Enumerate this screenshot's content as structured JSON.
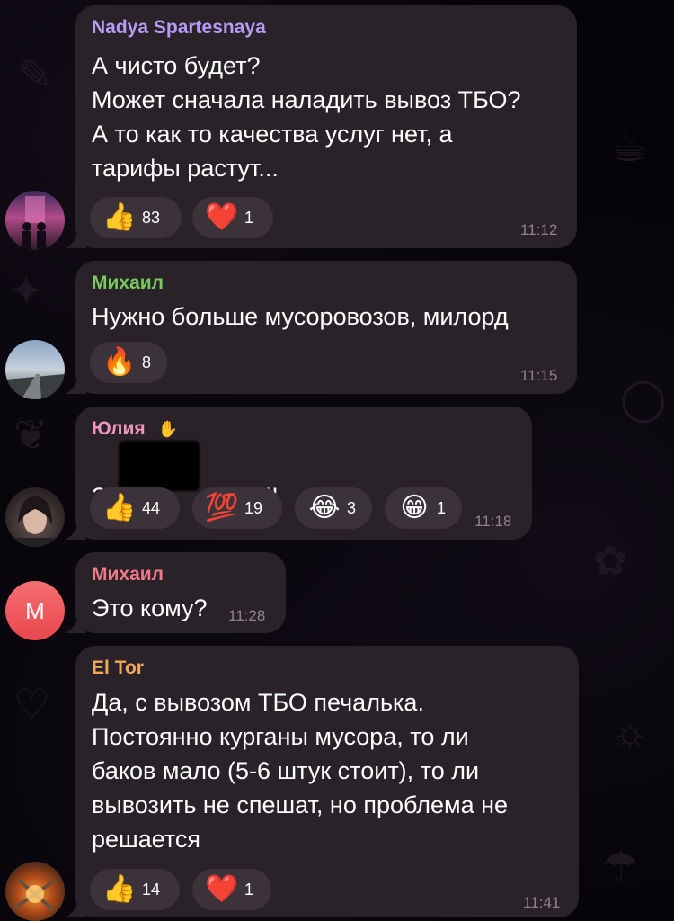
{
  "messages": [
    {
      "sender": "Nadya Spartesnaya",
      "sender_color": "#b79af5",
      "text": "А чисто будет?\nМожет сначала наладить вывоз ТБО?\nА то как то качества услуг нет, а\nтарифы растут...",
      "time": "11:12",
      "reactions": [
        {
          "emoji": "👍",
          "count": "83"
        },
        {
          "emoji": "❤️",
          "count": "1"
        }
      ]
    },
    {
      "sender": "Михаил",
      "sender_color": "#78c95e",
      "text": "Нужно больше мусоровозов, милорд",
      "time": "11:15",
      "reactions": [
        {
          "emoji": "🔥",
          "count": "8"
        }
      ]
    },
    {
      "sender": "Юлия",
      "sender_badge": "✋",
      "sender_color": "#f294c0",
      "text_start": "За",
      "text_end": "уже !!!!",
      "time": "11:18",
      "reactions": [
        {
          "emoji": "👍",
          "count": "44"
        },
        {
          "emoji": "💯",
          "count": "19"
        },
        {
          "emoji": "😂",
          "count": "3"
        },
        {
          "emoji": "😁",
          "count": "1"
        }
      ]
    },
    {
      "sender": "Михаил",
      "sender_color": "#f07a8a",
      "avatar_letter": "M",
      "text": "Это кому?",
      "time": "11:28"
    },
    {
      "sender": "El Tor",
      "sender_color": "#f0a75a",
      "text": "Да, с вывозом ТБО печалька.\nПостоянно курганы мусора, то ли\nбаков мало (5-6 штук стоит), то ли\nвывозить не спешат, но проблема не\nрешается",
      "time": "11:41",
      "reactions": [
        {
          "emoji": "👍",
          "count": "14"
        },
        {
          "emoji": "❤️",
          "count": "1"
        }
      ]
    }
  ]
}
